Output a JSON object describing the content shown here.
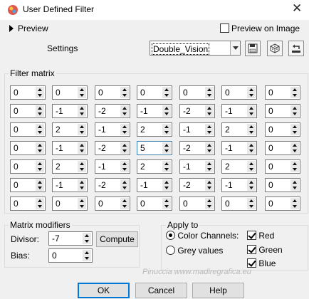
{
  "window": {
    "title": "User Defined Filter",
    "close_glyph": "✕"
  },
  "preview": {
    "label": "Preview",
    "preview_on_image_label": "Preview on Image",
    "preview_on_image_checked": false
  },
  "settings": {
    "label": "Settings",
    "preset_value": "Double_Vision"
  },
  "filter_matrix": {
    "title": "Filter matrix",
    "rows": [
      [
        "0",
        "0",
        "0",
        "0",
        "0",
        "0",
        "0"
      ],
      [
        "0",
        "-1",
        "-2",
        "-1",
        "-2",
        "-1",
        "0"
      ],
      [
        "0",
        "2",
        "-1",
        "2",
        "-1",
        "2",
        "0"
      ],
      [
        "0",
        "-1",
        "-2",
        "5",
        "-2",
        "-1",
        "0"
      ],
      [
        "0",
        "2",
        "-1",
        "2",
        "-1",
        "2",
        "0"
      ],
      [
        "0",
        "-1",
        "-2",
        "-1",
        "-2",
        "-1",
        "0"
      ],
      [
        "0",
        "0",
        "0",
        "0",
        "0",
        "0",
        "0"
      ]
    ]
  },
  "modifiers": {
    "title": "Matrix modifiers",
    "divisor_label": "Divisor:",
    "divisor_value": "-7",
    "bias_label": "Bias:",
    "bias_value": "0",
    "compute_label": "Compute"
  },
  "apply_to": {
    "title": "Apply to",
    "color_channels_label": "Color Channels:",
    "grey_values_label": "Grey values",
    "red_label": "Red",
    "green_label": "Green",
    "blue_label": "Blue"
  },
  "buttons": {
    "ok": "OK",
    "cancel": "Cancel",
    "help": "Help"
  },
  "watermark": "Pinuccia www.madiregrafica.eu"
}
